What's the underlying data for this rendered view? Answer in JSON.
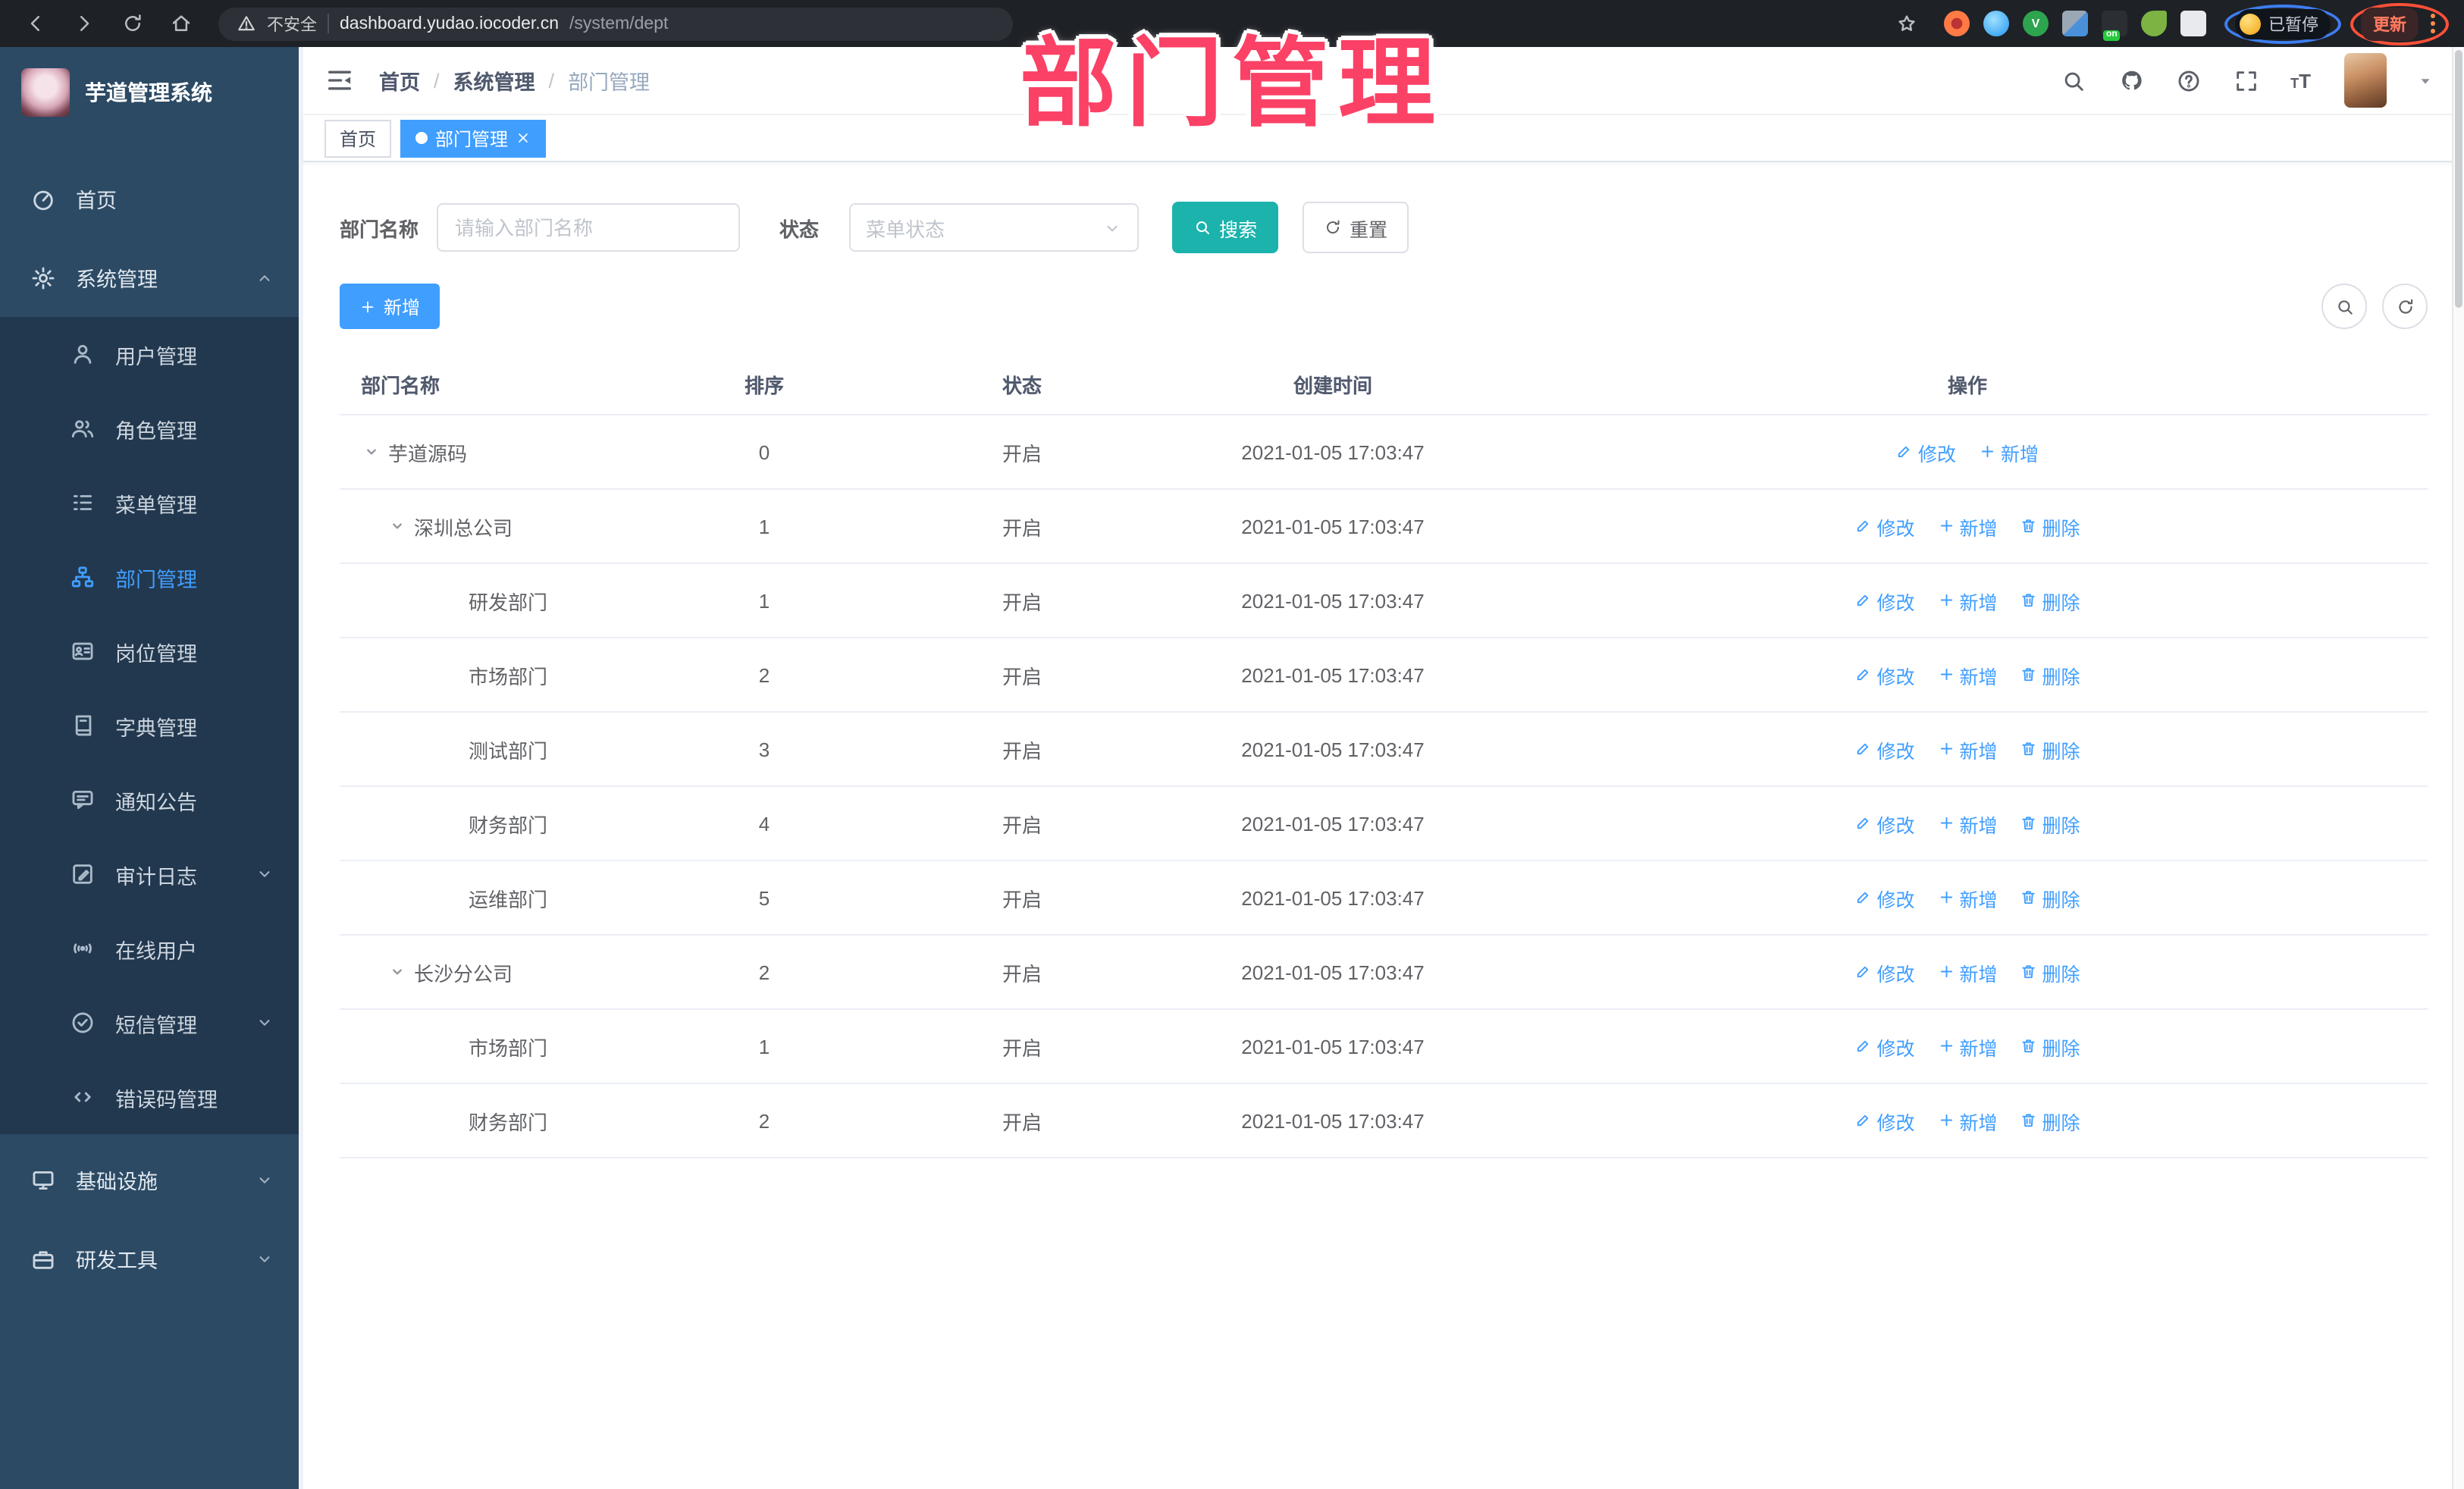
{
  "browser": {
    "security_label": "不安全",
    "url_host": "dashboard.yudao.iocoder.cn",
    "url_path": "/system/dept",
    "paused_label": "已暂停",
    "update_label": "更新",
    "extensions": [
      "bookmark-star",
      "ext-target",
      "ext-drop",
      "ext-v",
      "ext-grid",
      "ext-on-switch",
      "ext-leaf",
      "ext-puzzle"
    ]
  },
  "annotation": {
    "text": "部门管理"
  },
  "sidebar": {
    "app_title": "芋道管理系统",
    "menu_top": [
      {
        "key": "home",
        "label": "首页",
        "icon": "dashboard"
      },
      {
        "key": "system",
        "label": "系统管理",
        "icon": "gear",
        "arrow": "up"
      }
    ],
    "submenu": [
      {
        "key": "user-mgmt",
        "label": "用户管理",
        "icon": "user"
      },
      {
        "key": "role-mgmt",
        "label": "角色管理",
        "icon": "users"
      },
      {
        "key": "menu-mgmt",
        "label": "菜单管理",
        "icon": "menu-tree"
      },
      {
        "key": "dept-mgmt",
        "label": "部门管理",
        "icon": "org-tree",
        "active": true
      },
      {
        "key": "post-mgmt",
        "label": "岗位管理",
        "icon": "id-badge"
      },
      {
        "key": "dict-mgmt",
        "label": "字典管理",
        "icon": "book"
      },
      {
        "key": "notice",
        "label": "通知公告",
        "icon": "announcement"
      },
      {
        "key": "audit-log",
        "label": "审计日志",
        "icon": "audit-log",
        "arrow": "down"
      },
      {
        "key": "online-user",
        "label": "在线用户",
        "icon": "online"
      },
      {
        "key": "sms-mgmt",
        "label": "短信管理",
        "icon": "sms",
        "arrow": "down"
      },
      {
        "key": "errcode-mgmt",
        "label": "错误码管理",
        "icon": "code"
      }
    ],
    "menu_bottom": [
      {
        "key": "infra",
        "label": "基础设施",
        "icon": "monitor",
        "arrow": "down"
      },
      {
        "key": "dev-tools",
        "label": "研发工具",
        "icon": "toolbox",
        "arrow": "down"
      }
    ]
  },
  "header": {
    "breadcrumb": [
      {
        "label": "首页"
      },
      {
        "label": "系统管理"
      },
      {
        "label": "部门管理",
        "current": true
      }
    ]
  },
  "tabs": [
    {
      "key": "home",
      "label": "首页"
    },
    {
      "key": "dept",
      "label": "部门管理",
      "active": true,
      "closable": true
    }
  ],
  "filters": {
    "name_label": "部门名称",
    "name_placeholder": "请输入部门名称",
    "status_label": "状态",
    "status_placeholder": "菜单状态",
    "search_label": "搜索",
    "reset_label": "重置"
  },
  "toolbar": {
    "add_label": "新增"
  },
  "table": {
    "columns": [
      "部门名称",
      "排序",
      "状态",
      "创建时间",
      "操作"
    ],
    "rows": [
      {
        "name": "芋道源码",
        "level": 0,
        "expandable": true,
        "sort": "0",
        "status": "开启",
        "created": "2021-01-05 17:03:47",
        "actions": [
          "修改",
          "新增"
        ]
      },
      {
        "name": "深圳总公司",
        "level": 1,
        "expandable": true,
        "sort": "1",
        "status": "开启",
        "created": "2021-01-05 17:03:47",
        "actions": [
          "修改",
          "新增",
          "删除"
        ]
      },
      {
        "name": "研发部门",
        "level": 2,
        "expandable": false,
        "sort": "1",
        "status": "开启",
        "created": "2021-01-05 17:03:47",
        "actions": [
          "修改",
          "新增",
          "删除"
        ]
      },
      {
        "name": "市场部门",
        "level": 2,
        "expandable": false,
        "sort": "2",
        "status": "开启",
        "created": "2021-01-05 17:03:47",
        "actions": [
          "修改",
          "新增",
          "删除"
        ]
      },
      {
        "name": "测试部门",
        "level": 2,
        "expandable": false,
        "sort": "3",
        "status": "开启",
        "created": "2021-01-05 17:03:47",
        "actions": [
          "修改",
          "新增",
          "删除"
        ]
      },
      {
        "name": "财务部门",
        "level": 2,
        "expandable": false,
        "sort": "4",
        "status": "开启",
        "created": "2021-01-05 17:03:47",
        "actions": [
          "修改",
          "新增",
          "删除"
        ]
      },
      {
        "name": "运维部门",
        "level": 2,
        "expandable": false,
        "sort": "5",
        "status": "开启",
        "created": "2021-01-05 17:03:47",
        "actions": [
          "修改",
          "新增",
          "删除"
        ]
      },
      {
        "name": "长沙分公司",
        "level": 1,
        "expandable": true,
        "sort": "2",
        "status": "开启",
        "created": "2021-01-05 17:03:47",
        "actions": [
          "修改",
          "新增",
          "删除"
        ]
      },
      {
        "name": "市场部门",
        "level": 2,
        "expandable": false,
        "sort": "1",
        "status": "开启",
        "created": "2021-01-05 17:03:47",
        "actions": [
          "修改",
          "新增",
          "删除"
        ]
      },
      {
        "name": "财务部门",
        "level": 2,
        "expandable": false,
        "sort": "2",
        "status": "开启",
        "created": "2021-01-05 17:03:47",
        "actions": [
          "修改",
          "新增",
          "删除"
        ]
      }
    ]
  },
  "colors": {
    "accent": "#409eff",
    "search_button": "#1bb3ac",
    "annotation_pink": "#fb4166",
    "sidebar_bg": "#2c4a64",
    "submenu_bg": "#22384e",
    "tab_active": "#409eff"
  }
}
